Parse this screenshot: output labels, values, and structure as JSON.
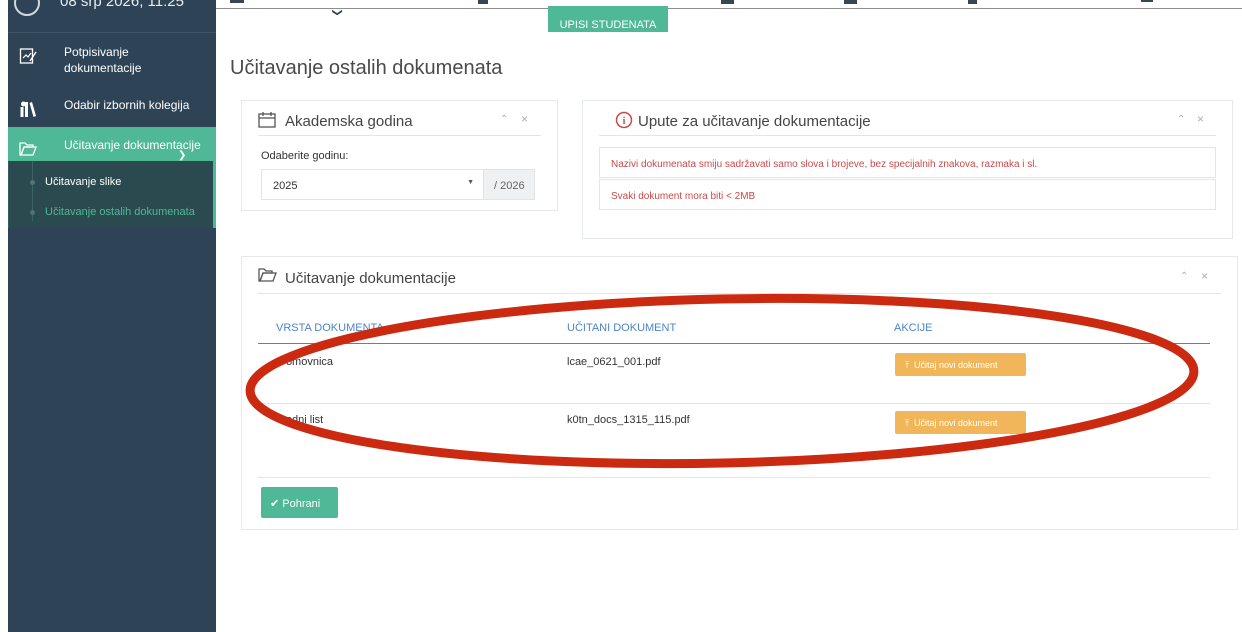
{
  "topbar": {
    "datetime": "08 srp 2026, 11:25",
    "badge": "UPISI STUDENATA"
  },
  "sidebar": {
    "items": [
      {
        "label_1": "Potpisivanje",
        "label_2": "dokumentacije",
        "icon": "signature-icon"
      },
      {
        "label": "Odabir izbornih kolegija",
        "icon": "books-icon"
      },
      {
        "label": "Učitavanje dokumentacije",
        "icon": "folder-open-icon"
      }
    ],
    "submenu": [
      {
        "label": "Učitavanje slike"
      },
      {
        "label": "Učitavanje ostalih dokumenata"
      }
    ]
  },
  "page": {
    "title": "Učitavanje ostalih dokumenata"
  },
  "year_panel": {
    "title": "Akademska godina",
    "select_label": "Odaberite godinu:",
    "selected_year": "2025",
    "end_year": "/ 2026"
  },
  "info_panel": {
    "title": "Upute za učitavanje dokumentacije",
    "notes": [
      "Nazivi dokumenata smiju sadržavati samo slova i brojeve, bez specijalnih znakova, razmaka i sl.",
      "Svaki dokument mora biti < 2MB"
    ]
  },
  "docs_panel": {
    "title": "Učitavanje dokumentacije",
    "columns": [
      "VRSTA DOKUMENTA",
      "UČITANI DOKUMENT",
      "AKCIJE"
    ],
    "rows": [
      {
        "type": "Domovnica",
        "file": "lcae_0621_001.pdf",
        "action": "Učitaj novi dokument"
      },
      {
        "type": "Rodni list",
        "file": "k0tn_docs_1315_115.pdf",
        "action": "Učitaj novi dokument"
      }
    ],
    "save_label": "Pohrani"
  },
  "colors": {
    "sidebar_bg": "#2e4456",
    "accent_green": "#4fb897",
    "upload_orange": "#f2b65a",
    "link_blue": "#4d84c9",
    "warning_red": "#c94a49",
    "annotation_red": "#cc2a10"
  }
}
